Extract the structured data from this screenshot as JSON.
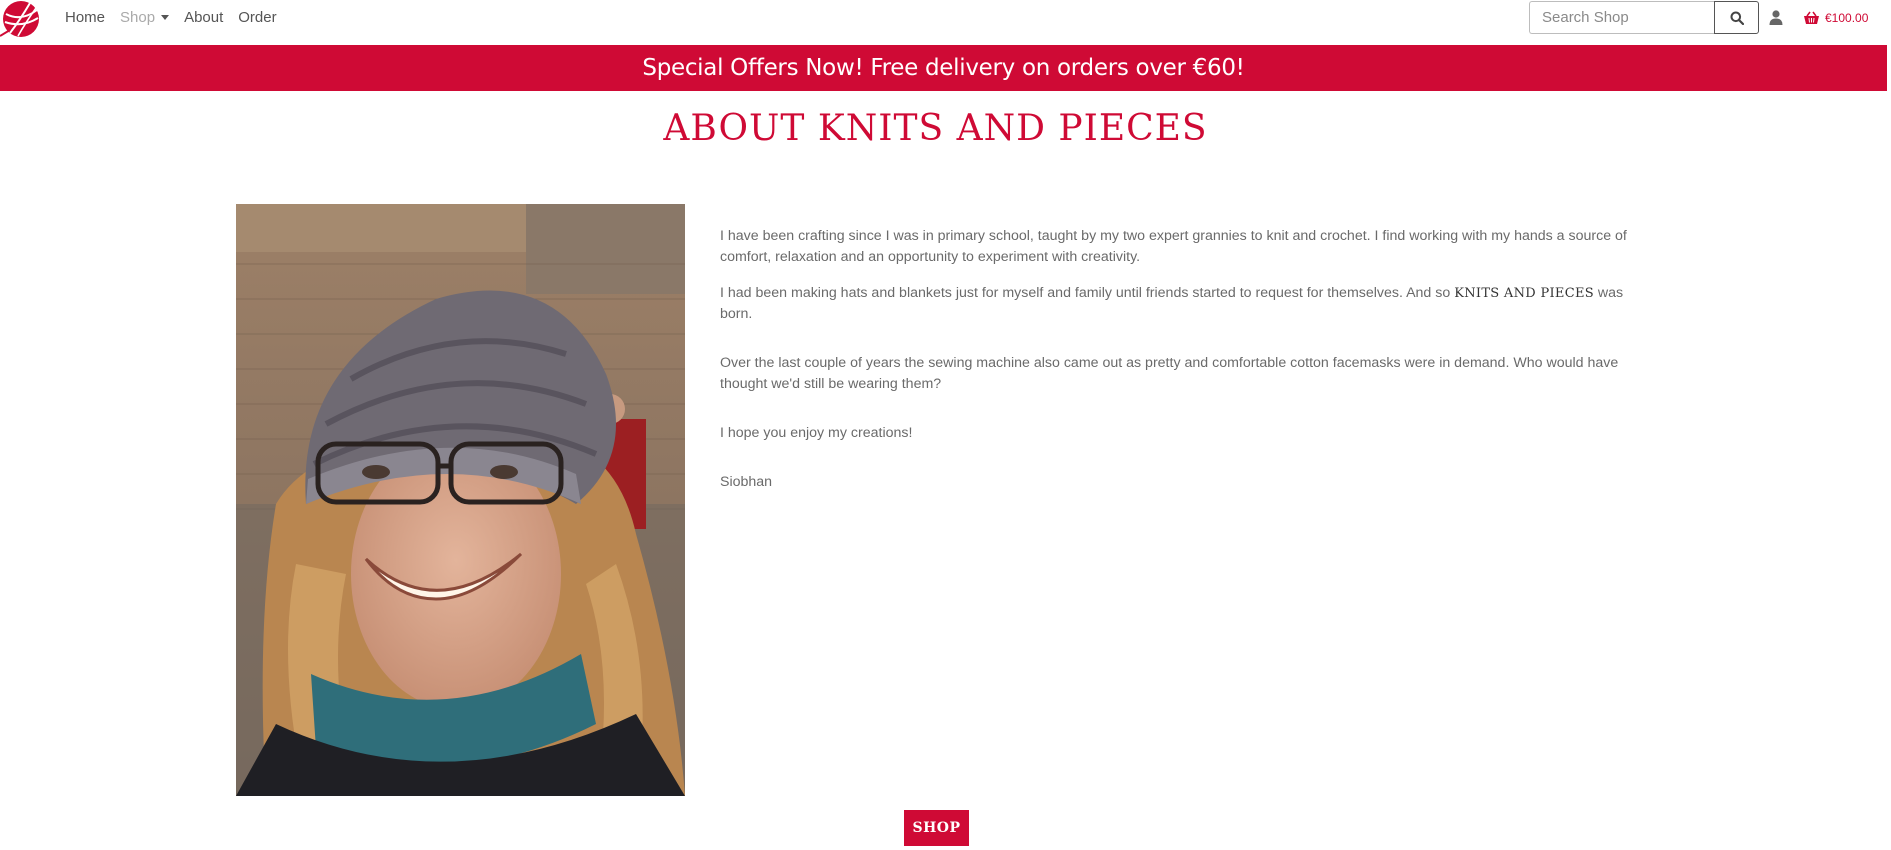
{
  "nav": {
    "links": [
      {
        "label": "Home"
      },
      {
        "label": "Shop"
      },
      {
        "label": "About"
      },
      {
        "label": "Order"
      }
    ],
    "search_placeholder": "Search Shop",
    "cart_total": "€100.00"
  },
  "banner": {
    "text": "Special Offers Now! Free delivery on orders over €60!"
  },
  "page": {
    "title": "ABOUT KNITS AND PIECES",
    "paragraphs": {
      "p1": "I have been crafting since I was in primary school, taught by my two expert grannies to knit and crochet. I find working with my hands a source of comfort, relaxation and an opportunity to experiment with creativity.",
      "p2_before": "I had been making hats and blankets just for myself and family until friends started to request for themselves. And so ",
      "p2_brand": "KNITS AND PIECES",
      "p2_after": " was born.",
      "p3": "Over the last couple of years the sewing machine also came out as pretty and comfortable cotton facemasks were in demand. Who would have thought we'd still be wearing them?",
      "p4": "I hope you enjoy my creations!",
      "signature": "Siobhan"
    },
    "shop_button": "SHOP"
  },
  "colors": {
    "brand_red": "#cf0a35",
    "text_grey": "#6a6a6a"
  },
  "icons": [
    "yarn-logo-icon",
    "caret-down-icon",
    "search-icon",
    "user-icon",
    "basket-icon"
  ]
}
